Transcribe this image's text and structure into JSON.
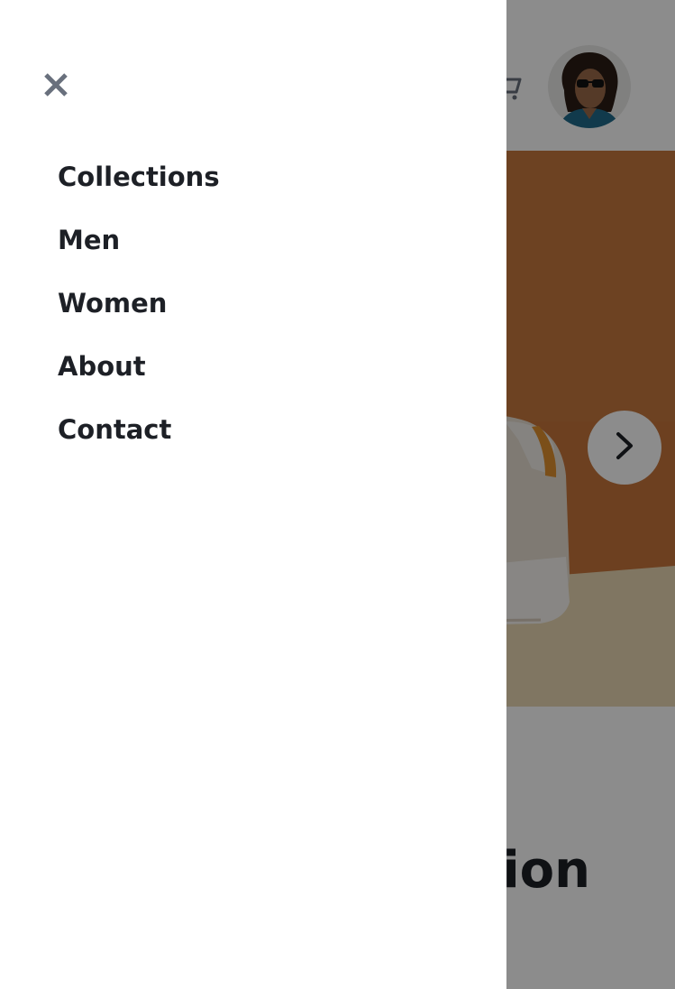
{
  "drawer": {
    "close_icon": "close-icon",
    "nav_items": [
      {
        "label": "Collections"
      },
      {
        "label": "Men"
      },
      {
        "label": "Women"
      },
      {
        "label": "About"
      },
      {
        "label": "Contact"
      }
    ]
  },
  "header": {
    "cart_icon": "cart-icon",
    "avatar_icon": "avatar"
  },
  "hero": {
    "next_icon": "chevron-right-icon",
    "heading_fragment": "ion"
  },
  "colors": {
    "text_dark": "#1d2026",
    "close_icon": "#69707d",
    "overlay": "rgba(0,0,0,0.45)",
    "hero_background": "#c6753b",
    "drawer_background": "#ffffff"
  }
}
